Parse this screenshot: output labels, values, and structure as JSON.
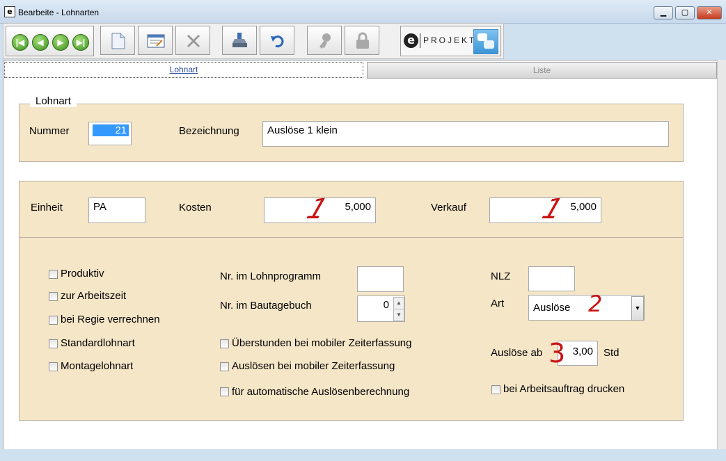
{
  "window": {
    "title": "Bearbeite - Lohnarten",
    "icon_glyph": "e"
  },
  "toolbar": {
    "logo_text": "PROJEKT:",
    "logo_letter": "e",
    "nav_icons": [
      "first-record-icon",
      "previous-record-icon",
      "next-record-icon",
      "last-record-icon"
    ],
    "nav_glyphs": {
      "first": "|◀",
      "prev": "◀",
      "next": "▶",
      "last": "▶|"
    },
    "action_icons": [
      "new-document-icon",
      "edit-form-icon",
      "delete-icon",
      "save-icon",
      "undo-icon",
      "key-icon",
      "lock-icon"
    ]
  },
  "tabs": {
    "lohnart": "Lohnart",
    "liste": "Liste"
  },
  "section1": {
    "legend": "Lohnart",
    "nummer_label": "Nummer",
    "nummer_value": "21",
    "bezeichnung_label": "Bezeichnung",
    "bezeichnung_value": "Auslöse 1 klein"
  },
  "section2": {
    "einheit_label": "Einheit",
    "einheit_value": "PA",
    "kosten_label": "Kosten",
    "kosten_value": "5,000",
    "verkauf_label": "Verkauf",
    "verkauf_value": "5,000"
  },
  "section3": {
    "checkboxes_left": [
      "Produktiv",
      "zur Arbeitszeit",
      "bei Regie verrechnen",
      "Standardlohnart",
      "Montagelohnart"
    ],
    "lohnprogramm_label": "Nr. im Lohnprogramm",
    "lohnprogramm_value": "",
    "bautagebuch_label": "Nr. im Bautagebuch",
    "bautagebuch_value": "0",
    "checkboxes_mid": [
      "Überstunden bei mobiler Zeiterfassung",
      "Auslösen bei mobiler Zeiterfassung",
      "für automatische Auslösenberechnung"
    ],
    "nlz_label": "NLZ",
    "nlz_value": "",
    "art_label": "Art",
    "art_value": "Auslöse",
    "ausloese_ab_label": "Auslöse ab",
    "ausloese_ab_value": "3,00",
    "ausloese_unit": "Std",
    "drucken_label": "bei Arbeitsauftrag drucken"
  },
  "annotations": {
    "mark1": "1",
    "mark2": "1",
    "mark3": "2",
    "mark4": "3"
  },
  "colors": {
    "panel": "#f5e6c8",
    "annotation": "#c81414",
    "selection": "#3399ff"
  }
}
